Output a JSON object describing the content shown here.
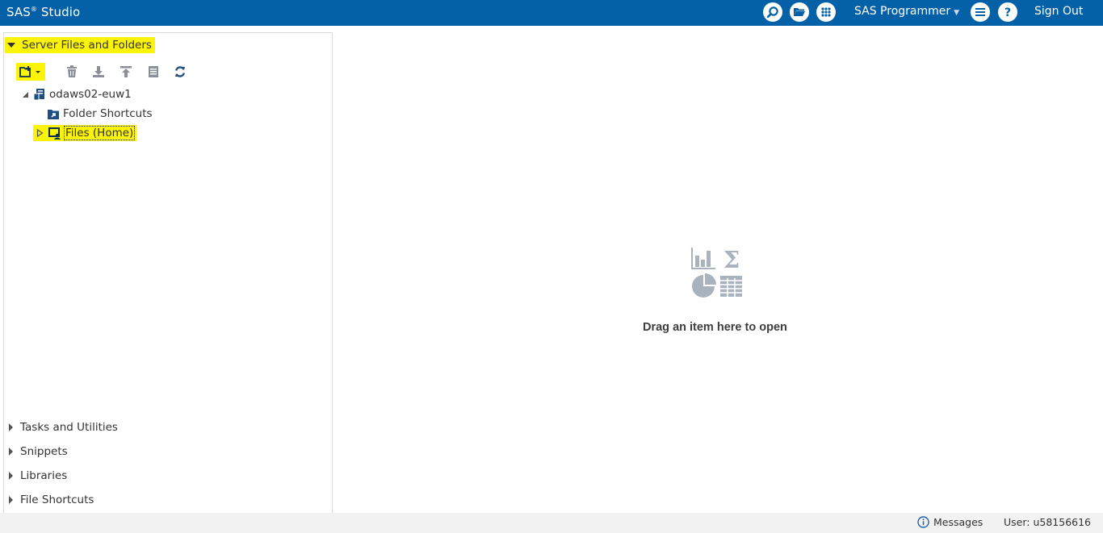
{
  "header": {
    "brand": "SAS",
    "brand_mark": "®",
    "product": "Studio",
    "role_label": "SAS Programmer",
    "sign_out_label": "Sign Out",
    "icons": [
      "search-icon",
      "open-folder-icon",
      "apps-grid-icon",
      "menu-list-icon",
      "help-icon"
    ],
    "color": "#0461a7"
  },
  "navigation": {
    "server_files": {
      "label": "Server Files and Folders",
      "toolbar": [
        "new-item-icon",
        "delete-icon",
        "download-icon",
        "upload-icon",
        "properties-icon",
        "refresh-icon"
      ],
      "tree": {
        "server": "odaws02-euw1",
        "children": [
          {
            "label": "Folder Shortcuts",
            "icon": "folder-shortcut-icon"
          },
          {
            "label": "Files (Home)",
            "icon": "home-folder-icon"
          }
        ]
      }
    },
    "sections": [
      {
        "label": "Tasks and Utilities"
      },
      {
        "label": "Snippets"
      },
      {
        "label": "Libraries"
      },
      {
        "label": "File Shortcuts"
      }
    ]
  },
  "workspace": {
    "drop_text": "Drag an item here to open",
    "icons": [
      "bar-chart-icon",
      "sigma-icon",
      "pie-chart-icon",
      "table-icon"
    ]
  },
  "status": {
    "messages_label": "Messages",
    "user_label": "User: u58156616"
  },
  "highlight_color": "#fbf404"
}
